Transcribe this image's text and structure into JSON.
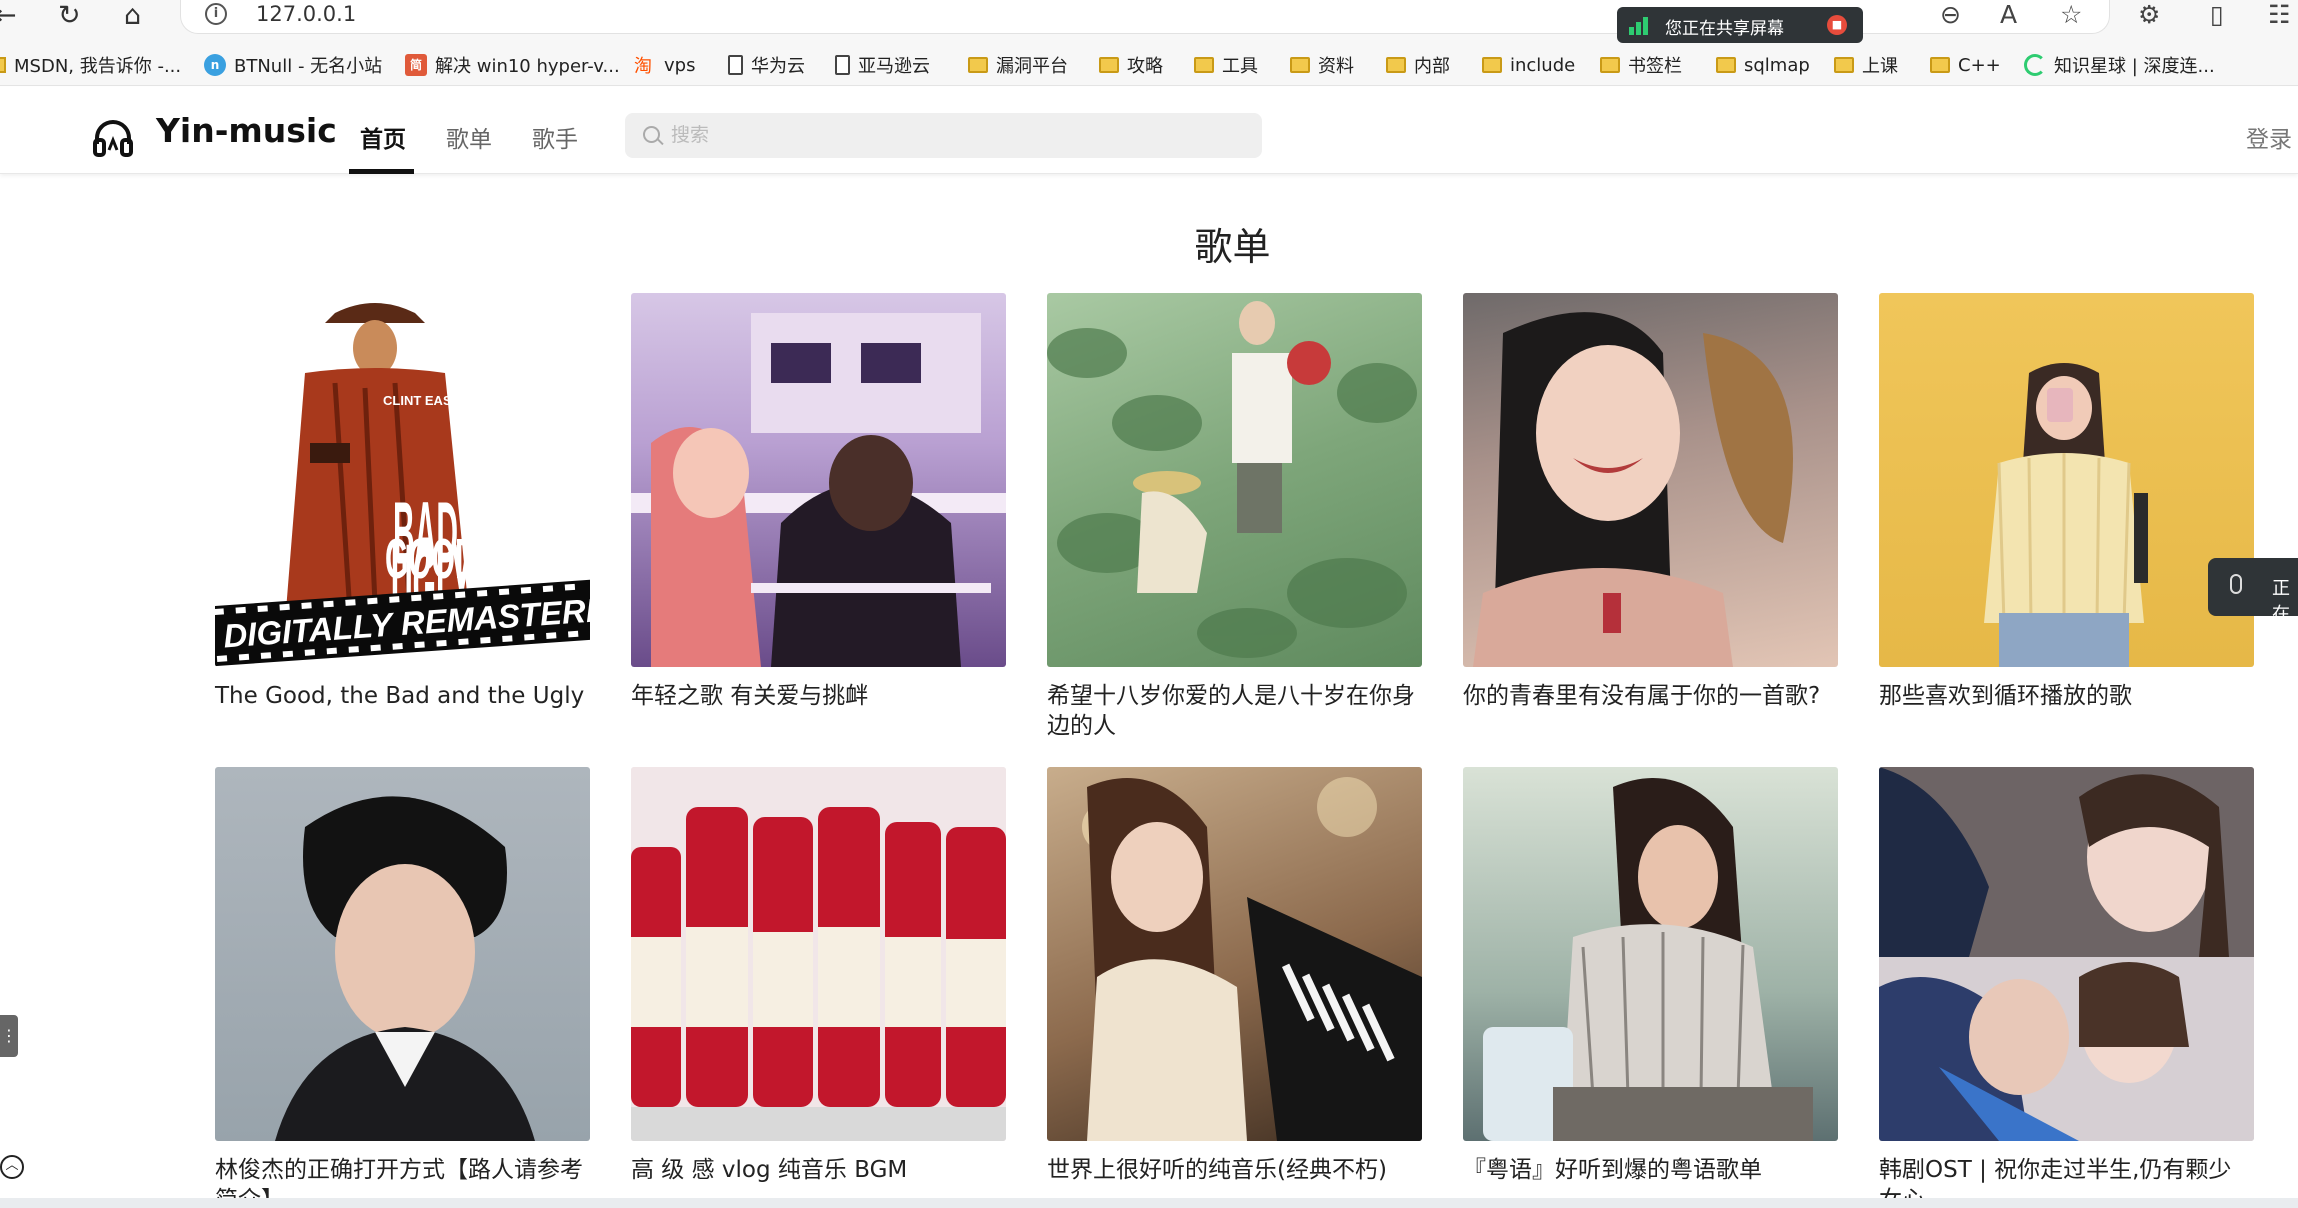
{
  "browser": {
    "url": "127.0.0.1",
    "sharing_text": "您正在共享屏幕",
    "bookmarks": [
      {
        "label": "MSDN, 我告诉你 -...",
        "icon": "msdn-icon"
      },
      {
        "label": "BTNull - 无名小站",
        "icon": "btnull-icon"
      },
      {
        "label": "解决 win10 hyper-v...",
        "icon": "jian-icon"
      },
      {
        "label": "vps",
        "icon": "taobao-icon"
      },
      {
        "label": "华为云",
        "icon": "page-icon"
      },
      {
        "label": "亚马逊云",
        "icon": "page-icon"
      },
      {
        "label": "漏洞平台",
        "icon": "folder-icon"
      },
      {
        "label": "攻略",
        "icon": "folder-icon"
      },
      {
        "label": "工具",
        "icon": "folder-icon"
      },
      {
        "label": "资料",
        "icon": "folder-icon"
      },
      {
        "label": "内部",
        "icon": "folder-icon"
      },
      {
        "label": "include",
        "icon": "folder-icon"
      },
      {
        "label": "书签栏",
        "icon": "folder-icon"
      },
      {
        "label": "sqlmap",
        "icon": "folder-icon"
      },
      {
        "label": "上课",
        "icon": "folder-icon"
      },
      {
        "label": "C++",
        "icon": "folder-icon"
      },
      {
        "label": "知识星球 | 深度连...",
        "icon": "zsxq-icon"
      }
    ]
  },
  "header": {
    "logo_text": "Yin-music",
    "nav": [
      {
        "label": "首页",
        "active": true
      },
      {
        "label": "歌单",
        "active": false
      },
      {
        "label": "歌手",
        "active": false
      }
    ],
    "search_placeholder": "搜索",
    "login_label": "登录"
  },
  "main": {
    "section_title": "歌单",
    "playlists": [
      {
        "title": "The Good, the Bad and the Ugly",
        "cover_text": "DIGITALLY REMASTERED",
        "cover_subtitle": "THE GOOD BAD AND THE UGLY",
        "cover_credit": "CLINT EASTWOOD"
      },
      {
        "title": "年轻之歌 有关爱与挑衅"
      },
      {
        "title": "希望十八岁你爱的人是八十岁在你身边的人"
      },
      {
        "title": "你的青春里有没有属于你的一首歌?"
      },
      {
        "title": "那些喜欢到循环播放的歌"
      },
      {
        "title": "林俊杰的正确打开方式【路人请参考简介】"
      },
      {
        "title": "高 级 感 vlog 纯音乐 BGM"
      },
      {
        "title": "世界上很好听的纯音乐(经典不朽)"
      },
      {
        "title": "『粤语』好听到爆的粤语歌单"
      },
      {
        "title": "韩剧OST | 祝你走过半生,仍有颗少女心"
      }
    ]
  },
  "overlays": {
    "voice_text": "正在"
  }
}
